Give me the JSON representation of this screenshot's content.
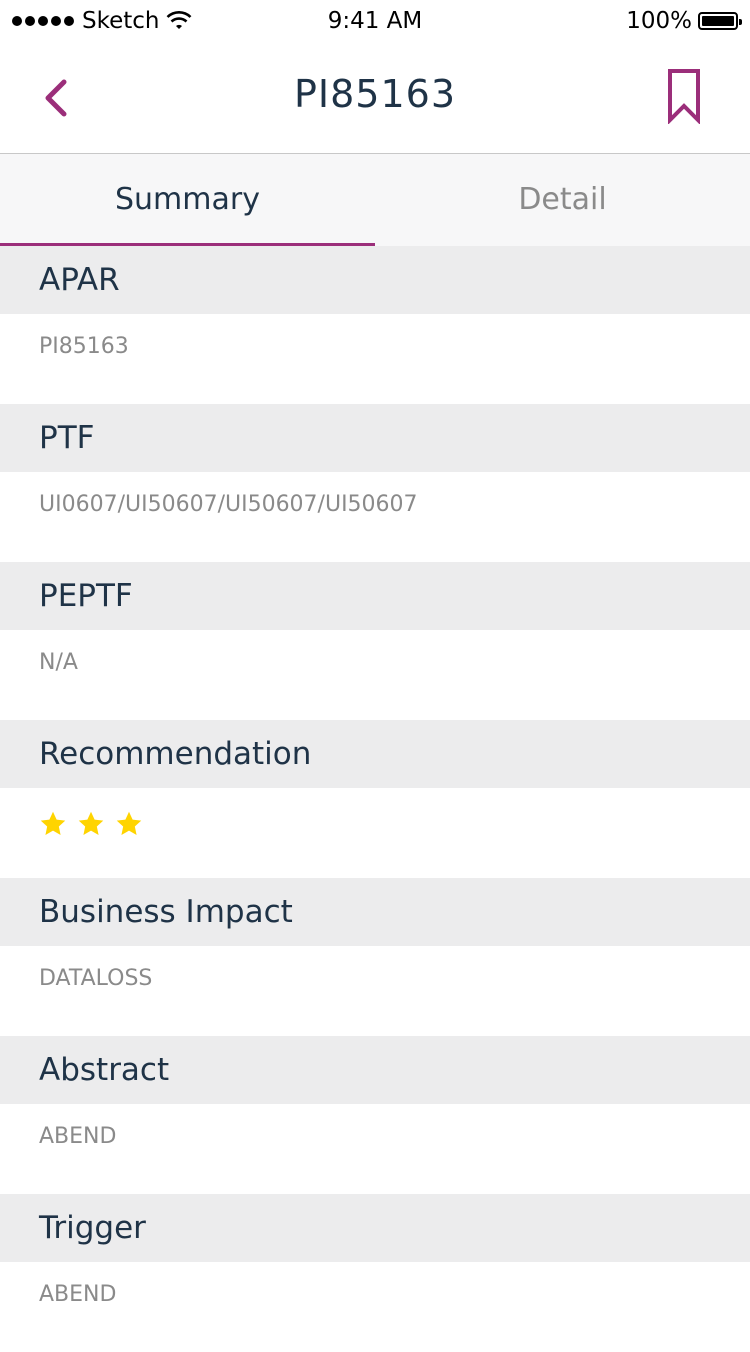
{
  "status": {
    "carrier": "Sketch",
    "time": "9:41 AM",
    "battery": "100%",
    "battery_level": 1.0
  },
  "nav": {
    "title": "PI85163"
  },
  "tabs": [
    {
      "label": "Summary",
      "active": true
    },
    {
      "label": "Detail",
      "active": false
    }
  ],
  "sections": {
    "apar": {
      "label": "APAR",
      "value": "PI85163"
    },
    "ptf": {
      "label": "PTF",
      "value": "UI0607/UI50607/UI50607/UI50607"
    },
    "peptf": {
      "label": "PEPTF",
      "value": "N/A"
    },
    "recommendation": {
      "label": "Recommendation",
      "stars": 3
    },
    "business_impact": {
      "label": "Business Impact",
      "value": "DATALOSS"
    },
    "abstract": {
      "label": "Abstract",
      "value": "ABEND"
    },
    "trigger": {
      "label": "Trigger",
      "value": "ABEND"
    }
  },
  "colors": {
    "accent": "#9b2e7a",
    "star": "#ffd400",
    "heading": "#1f3347",
    "muted": "#8a8a8a"
  },
  "icons": [
    "signal-dots-icon",
    "wifi-icon",
    "battery-icon",
    "back-chevron-icon",
    "bookmark-icon",
    "star-icon"
  ]
}
